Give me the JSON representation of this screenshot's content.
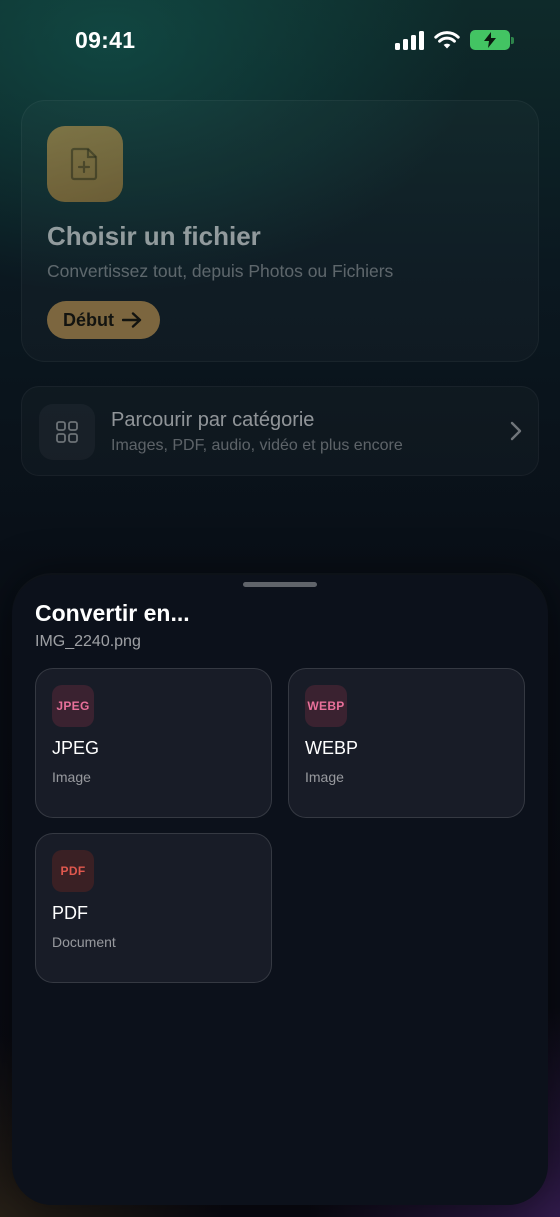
{
  "status_bar": {
    "time": "09:41",
    "battery_color": "#43c463"
  },
  "choose_card": {
    "icon": "file-plus-icon",
    "accent": "#d9a85a",
    "title": "Choisir un fichier",
    "subtitle": "Convertissez tout, depuis Photos ou Fichiers",
    "start_button": "Début"
  },
  "browse_card": {
    "icon": "grid-icon",
    "title": "Parcourir par catégorie",
    "subtitle": "Images, PDF, audio, vidéo et plus encore"
  },
  "sheet": {
    "title": "Convertir en...",
    "filename": "IMG_2240.png",
    "formats": [
      {
        "badge": "JPEG",
        "name": "JPEG",
        "type": "Image",
        "badge_color": "#e8709a",
        "badge_bg": "#3a2230"
      },
      {
        "badge": "WEBP",
        "name": "WEBP",
        "type": "Image",
        "badge_color": "#e8709a",
        "badge_bg": "#3a2230"
      },
      {
        "badge": "PDF",
        "name": "PDF",
        "type": "Document",
        "badge_color": "#e0584e",
        "badge_bg": "#3a2024"
      }
    ]
  }
}
